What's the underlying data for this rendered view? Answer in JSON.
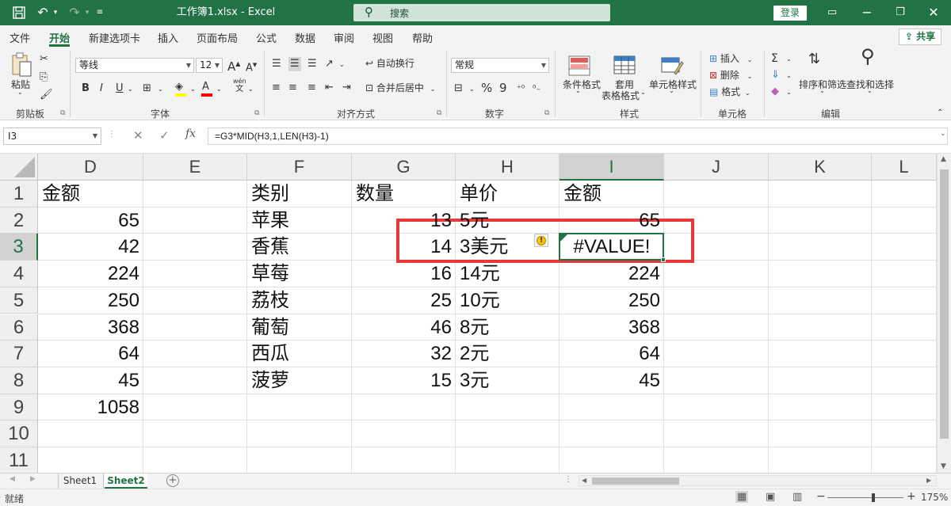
{
  "window": {
    "title": "工作簿1.xlsx  -  Excel",
    "search_placeholder": "搜索",
    "login_label": "登录"
  },
  "menu": {
    "tabs": [
      "文件",
      "开始",
      "新建选项卡",
      "插入",
      "页面布局",
      "公式",
      "数据",
      "审阅",
      "视图",
      "帮助"
    ],
    "active_tab": "开始",
    "share_label": "共享"
  },
  "ribbon": {
    "clipboard": {
      "paste_label": "粘贴",
      "group_label": "剪贴板"
    },
    "font": {
      "font_name": "等线",
      "font_size": "12",
      "group_label": "字体",
      "bold": "B",
      "italic": "I",
      "underline": "U",
      "grow": "A",
      "shrink": "A",
      "pinyin_top": "wén",
      "pinyin_bottom": "文",
      "fill_color": "#ffff00",
      "font_color": "#ff0000"
    },
    "alignment": {
      "wrap_label": "自动换行",
      "merge_label": "合并后居中",
      "group_label": "对齐方式"
    },
    "number": {
      "format": "常规",
      "group_label": "数字",
      "percent": "%",
      "comma": "9"
    },
    "styles": {
      "conditional_label": "条件格式",
      "table_label_1": "套用",
      "table_label_2": "表格格式",
      "cell_styles_label": "单元格样式",
      "group_label": "样式"
    },
    "cells": {
      "insert_label": "插入",
      "delete_label": "删除",
      "format_label": "格式",
      "group_label": "单元格"
    },
    "editing": {
      "sort_label": "排序和筛选",
      "find_label": "查找和选择",
      "group_label": "编辑"
    }
  },
  "formula_bar": {
    "name_box": "I3",
    "formula": "=G3*MID(H3,1,LEN(H3)-1)",
    "fx": "fx"
  },
  "sheet": {
    "columns": [
      "D",
      "E",
      "F",
      "G",
      "H",
      "I",
      "J",
      "K",
      "L"
    ],
    "selected_column": "I",
    "rows": [
      "1",
      "2",
      "3",
      "4",
      "5",
      "6",
      "7",
      "8",
      "9",
      "10",
      "11"
    ],
    "selected_row": "3",
    "cells": {
      "D1": "金额",
      "D2": "65",
      "D3": "42",
      "D4": "224",
      "D5": "250",
      "D6": "368",
      "D7": "64",
      "D8": "45",
      "D9": "1058",
      "F1": "类别",
      "F2": "苹果",
      "F3": "香蕉",
      "F4": "草莓",
      "F5": "荔枝",
      "F6": "葡萄",
      "F7": "西瓜",
      "F8": "菠萝",
      "G1": "数量",
      "G2": "13",
      "G3": "14",
      "G4": "16",
      "G5": "25",
      "G6": "46",
      "G7": "32",
      "G8": "15",
      "H1": "单价",
      "H2": "5元",
      "H3": "3美元",
      "H4": "14元",
      "H5": "10元",
      "H6": "8元",
      "H7": "2元",
      "H8": "3元",
      "I1": "金额",
      "I2": "65",
      "I3": "#VALUE!",
      "I4": "224",
      "I5": "250",
      "I6": "368",
      "I7": "64",
      "I8": "45"
    },
    "error_marker": "!",
    "highlight_color": "#e8393a",
    "accent_color": "#217346"
  },
  "sheet_tabs": {
    "tabs": [
      "Sheet1",
      "Sheet2"
    ],
    "active": "Sheet2",
    "add": "+"
  },
  "status": {
    "ready": "就绪",
    "zoom": "175%",
    "zoom_minus": "−",
    "zoom_plus": "+"
  }
}
